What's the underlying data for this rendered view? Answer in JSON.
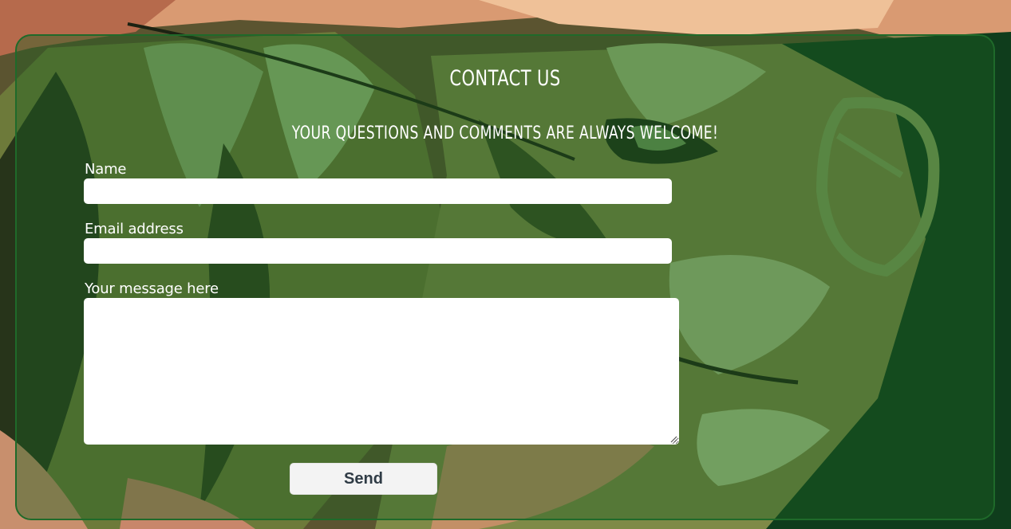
{
  "page": {
    "background_description_colors": {
      "dark_green": "#1f4f1f",
      "olive": "#6e7a3a",
      "skin": "#e9b98f",
      "accent": "#1f6a2a"
    }
  },
  "contact": {
    "title": "CONTACT US",
    "subtitle": "YOUR QUESTIONS AND COMMENTS ARE ALWAYS WELCOME!",
    "fields": {
      "name_label": "Name",
      "name_value": "",
      "email_label": "Email address",
      "email_value": "",
      "message_label": "Your message here",
      "message_value": ""
    },
    "send_label": "Send"
  }
}
